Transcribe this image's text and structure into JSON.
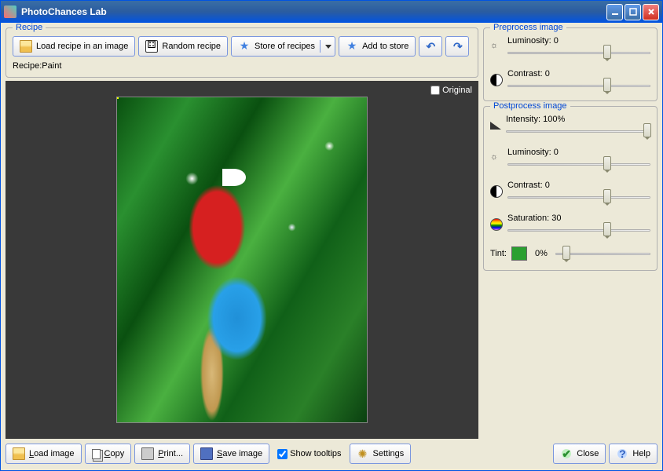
{
  "window": {
    "title": "PhotoChances Lab"
  },
  "recipe": {
    "legend": "Recipe",
    "load": "Load recipe in an image",
    "random": "Random recipe",
    "store": "Store of recipes",
    "add": "Add to store",
    "name_label": "Recipe:",
    "name_value": "Paint"
  },
  "canvas": {
    "original": "Original"
  },
  "preprocess": {
    "legend": "Preprocess image",
    "luminosity": {
      "label": "Luminosity:",
      "value": "0",
      "pos": 70
    },
    "contrast": {
      "label": "Contrast:",
      "value": "0",
      "pos": 70
    }
  },
  "postprocess": {
    "legend": "Postprocess image",
    "intensity": {
      "label": "Intensity:",
      "value": "100%",
      "pos": 98
    },
    "luminosity": {
      "label": "Luminosity:",
      "value": "0",
      "pos": 70
    },
    "contrast": {
      "label": "Contrast:",
      "value": "0",
      "pos": 70
    },
    "saturation": {
      "label": "Saturation:",
      "value": "30",
      "pos": 70
    },
    "tint": {
      "label": "Tint:",
      "value": "0%",
      "color": "#2aa030",
      "pos": 12
    }
  },
  "bottom": {
    "load": "Load image",
    "copy": "Copy",
    "print": "Print...",
    "save": "Save image",
    "tooltips": "Show tooltips",
    "settings": "Settings",
    "close": "Close",
    "help": "Help"
  }
}
